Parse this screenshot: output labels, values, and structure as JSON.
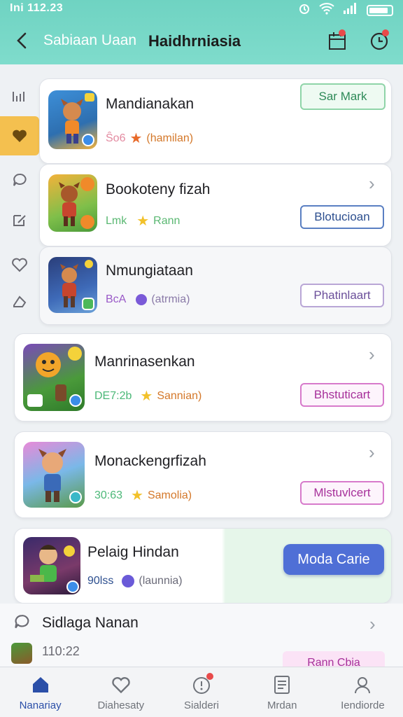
{
  "status_bar": {
    "time": "Ini 112.23"
  },
  "header": {
    "subtitle": "Sabiaan Uaan",
    "title": "Haidhrniasia"
  },
  "colors": {
    "teal": "#6fd3c2",
    "accent_yellow": "#f4c04f",
    "nav_active": "#2b4fa8"
  },
  "rail": {
    "items": [
      "list-icon",
      "heart-icon",
      "chat-icon",
      "edit-icon",
      "heart-outline-icon",
      "tag-icon"
    ],
    "active_index": 1
  },
  "cards": [
    {
      "name": "Mandianakan",
      "meta_code": "Ŝo6",
      "meta_tag": "(hamilan)",
      "button": "Sar Mark",
      "has_chevron": false
    },
    {
      "name": "Bookoteny fizah",
      "meta_code": "Lmk",
      "meta_tag": "Rann",
      "button": "Blotucioan",
      "has_chevron": true
    },
    {
      "name": "Nmungiataan",
      "meta_code": "BcA",
      "meta_tag": "(atrmia)",
      "button": "Phatinlaart",
      "has_chevron": false
    },
    {
      "name": "Manrinasenkan",
      "meta_code": "DE7:2b",
      "meta_tag": "Sannian)",
      "button": "Bhstuticart",
      "has_chevron": true
    },
    {
      "name": "Monackengrfizah",
      "meta_code": "30:63",
      "meta_tag": "Samolia)",
      "button": "Mlstuvlcert",
      "has_chevron": true
    },
    {
      "name": "Pelaig Hindan",
      "meta_code": "90lss",
      "meta_tag": "(launnia)",
      "button": "Moda Carie",
      "has_chevron": false
    }
  ],
  "list_row": {
    "title": "Sidlaga Nanan",
    "time": "110:22",
    "button": "Rann Cbia"
  },
  "nav": [
    {
      "label": "Nanariay",
      "icon": "home-icon"
    },
    {
      "label": "Diahesaty",
      "icon": "heart-icon"
    },
    {
      "label": "Sialderi",
      "icon": "bell-icon"
    },
    {
      "label": "Mrdan",
      "icon": "document-icon"
    },
    {
      "label": "Iendiorde",
      "icon": "profile-icon"
    }
  ]
}
